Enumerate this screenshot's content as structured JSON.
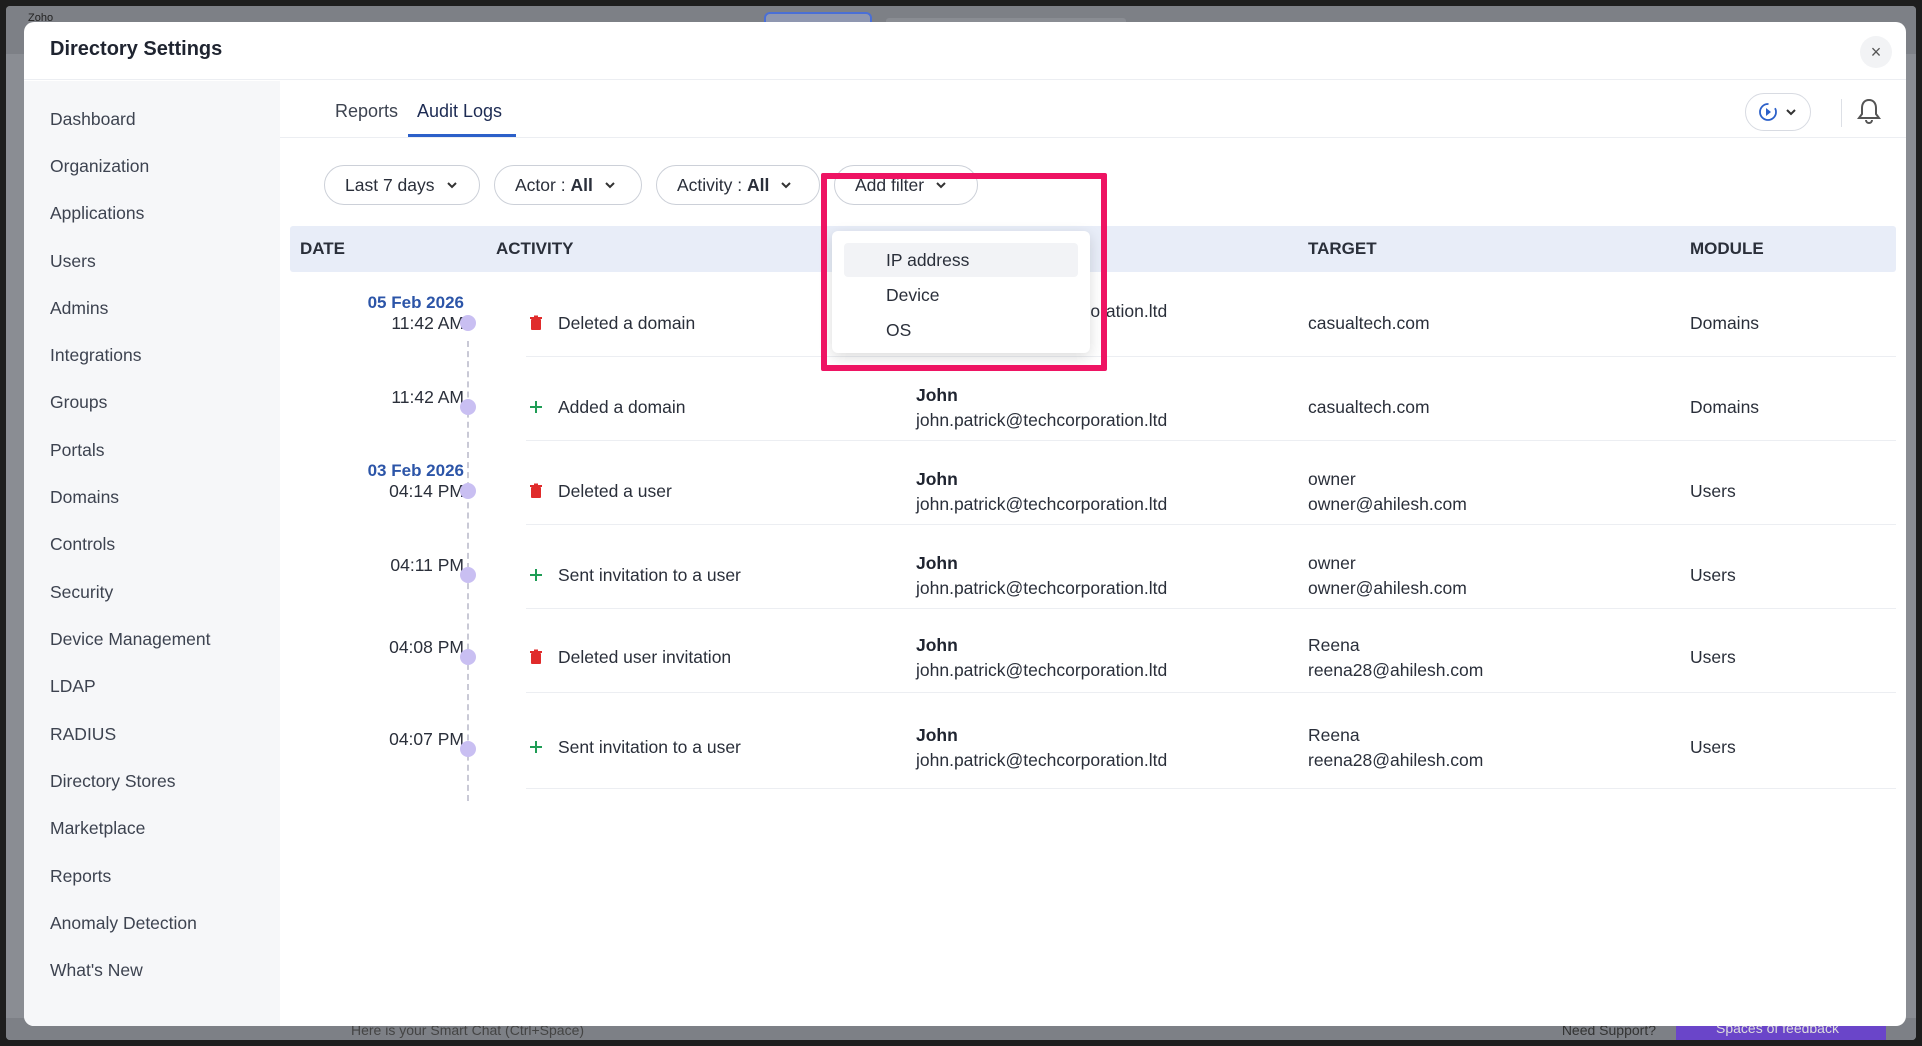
{
  "bg": {
    "logo": "Zoho",
    "chat_placeholder": "Here is your Smart Chat (Ctrl+Space)",
    "support": "Need Support?",
    "feedback": "Spaces of feedback"
  },
  "modal": {
    "title": "Directory Settings",
    "close": "×"
  },
  "sidebar": {
    "items": [
      "Dashboard",
      "Organization",
      "Applications",
      "Users",
      "Admins",
      "Integrations",
      "Groups",
      "Portals",
      "Domains",
      "Controls",
      "Security",
      "Device Management",
      "LDAP",
      "RADIUS",
      "Directory Stores",
      "Marketplace",
      "Reports",
      "Anomaly Detection",
      "What's New"
    ]
  },
  "tabs": {
    "reports": "Reports",
    "audit_logs": "Audit Logs"
  },
  "filters": {
    "period": "Last 7 days",
    "actor_label": "Actor : ",
    "actor_value": "All",
    "activity_label": "Activity : ",
    "activity_value": "All",
    "add_filter": "Add filter"
  },
  "table": {
    "headers": {
      "date": "DATE",
      "activity": "ACTIVITY",
      "target": "TARGET",
      "module": "MODULE"
    },
    "rows": [
      {
        "day": "05 Feb 2026",
        "time": "11:42 AM",
        "type": "delete",
        "activity": "Deleted a domain",
        "actor_name": "",
        "actor_email": "john.patrick@techcorporation.ltd",
        "target_name": "",
        "target_value": "casualtech.com",
        "module": "Domains"
      },
      {
        "day": "",
        "time": "11:42 AM",
        "type": "add",
        "activity": "Added a domain",
        "actor_name": "John",
        "actor_email": "john.patrick@techcorporation.ltd",
        "target_name": "",
        "target_value": "casualtech.com",
        "module": "Domains"
      },
      {
        "day": "03 Feb 2026",
        "time": "04:14 PM",
        "type": "delete",
        "activity": "Deleted a user",
        "actor_name": "John",
        "actor_email": "john.patrick@techcorporation.ltd",
        "target_name": "owner",
        "target_value": "owner@ahilesh.com",
        "module": "Users"
      },
      {
        "day": "",
        "time": "04:11 PM",
        "type": "add",
        "activity": "Sent invitation to a user",
        "actor_name": "John",
        "actor_email": "john.patrick@techcorporation.ltd",
        "target_name": "owner",
        "target_value": "owner@ahilesh.com",
        "module": "Users"
      },
      {
        "day": "",
        "time": "04:08 PM",
        "type": "delete",
        "activity": "Deleted user invitation",
        "actor_name": "John",
        "actor_email": "john.patrick@techcorporation.ltd",
        "target_name": "Reena",
        "target_value": "reena28@ahilesh.com",
        "module": "Users"
      },
      {
        "day": "",
        "time": "04:07 PM",
        "type": "add",
        "activity": "Sent invitation to a user",
        "actor_name": "John",
        "actor_email": "john.patrick@techcorporation.ltd",
        "target_name": "Reena",
        "target_value": "reena28@ahilesh.com",
        "module": "Users"
      }
    ]
  },
  "dropdown": {
    "items": [
      "IP address",
      "Device",
      "OS"
    ]
  },
  "colors": {
    "accent": "#2c60c9",
    "highlight": "#ee1463",
    "delete_icon": "#e02b2b",
    "add_icon": "#1f9d55"
  },
  "icons": {
    "close": "close-icon",
    "sync": "sync-icon",
    "bell": "bell-icon",
    "chevron": "chevron-down-icon",
    "delete": "trash-icon",
    "add": "plus-icon"
  }
}
